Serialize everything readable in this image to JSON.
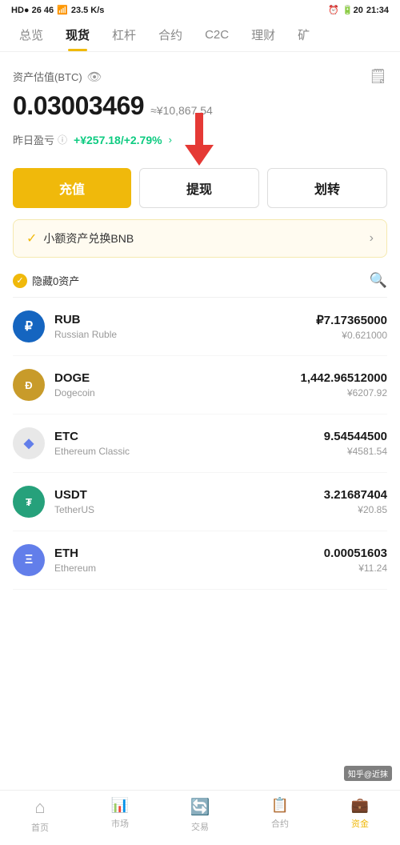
{
  "statusBar": {
    "left": "HD● 26 46 ⟳",
    "network": "23.5 K/s",
    "time": "21:34",
    "battery": "20"
  },
  "navTabs": {
    "items": [
      {
        "label": "总览",
        "active": false
      },
      {
        "label": "现货",
        "active": true
      },
      {
        "label": "杠杆",
        "active": false
      },
      {
        "label": "合约",
        "active": false
      },
      {
        "label": "C2C",
        "active": false
      },
      {
        "label": "理财",
        "active": false
      },
      {
        "label": "矿",
        "active": false
      }
    ]
  },
  "assetSection": {
    "title": "资产估值(BTC)",
    "btcValue": "0.03003469",
    "cnyApprox": "≈¥10,867.54",
    "pnlLabel": "昨日盈亏",
    "pnlValue": "+¥257.18/+2.79%"
  },
  "actionButtons": {
    "deposit": "充值",
    "withdraw": "提现",
    "transfer": "划转"
  },
  "bnbBanner": {
    "text": "小额资产兑换BNB"
  },
  "assetListHeader": {
    "hideLabel": "隐藏0资产"
  },
  "coins": [
    {
      "symbol": "RUB",
      "name": "Russian Ruble",
      "amount": "₽7.17365000",
      "cny": "¥0.621000",
      "iconType": "rub",
      "iconText": "₽"
    },
    {
      "symbol": "DOGE",
      "name": "Dogecoin",
      "amount": "1,442.96512000",
      "cny": "¥6207.92",
      "iconType": "doge",
      "iconText": "Ð"
    },
    {
      "symbol": "ETC",
      "name": "Ethereum Classic",
      "amount": "9.54544500",
      "cny": "¥4581.54",
      "iconType": "etc",
      "iconText": "◆"
    },
    {
      "symbol": "USDT",
      "name": "TetherUS",
      "amount": "3.21687404",
      "cny": "¥20.85",
      "iconType": "usdt",
      "iconText": "₮"
    },
    {
      "symbol": "ETH",
      "name": "Ethereum",
      "amount": "0.00051603",
      "cny": "¥11.24",
      "iconType": "eth",
      "iconText": "Ξ"
    }
  ],
  "bottomNav": {
    "items": [
      {
        "label": "首页",
        "icon": "⌂",
        "active": false
      },
      {
        "label": "市场",
        "icon": "⬛",
        "active": false
      },
      {
        "label": "交易",
        "icon": "⟳",
        "active": false
      },
      {
        "label": "合约",
        "icon": "📋",
        "active": false
      },
      {
        "label": "资金",
        "icon": "💰",
        "active": true
      }
    ]
  },
  "watermark": "知乎@近抹"
}
